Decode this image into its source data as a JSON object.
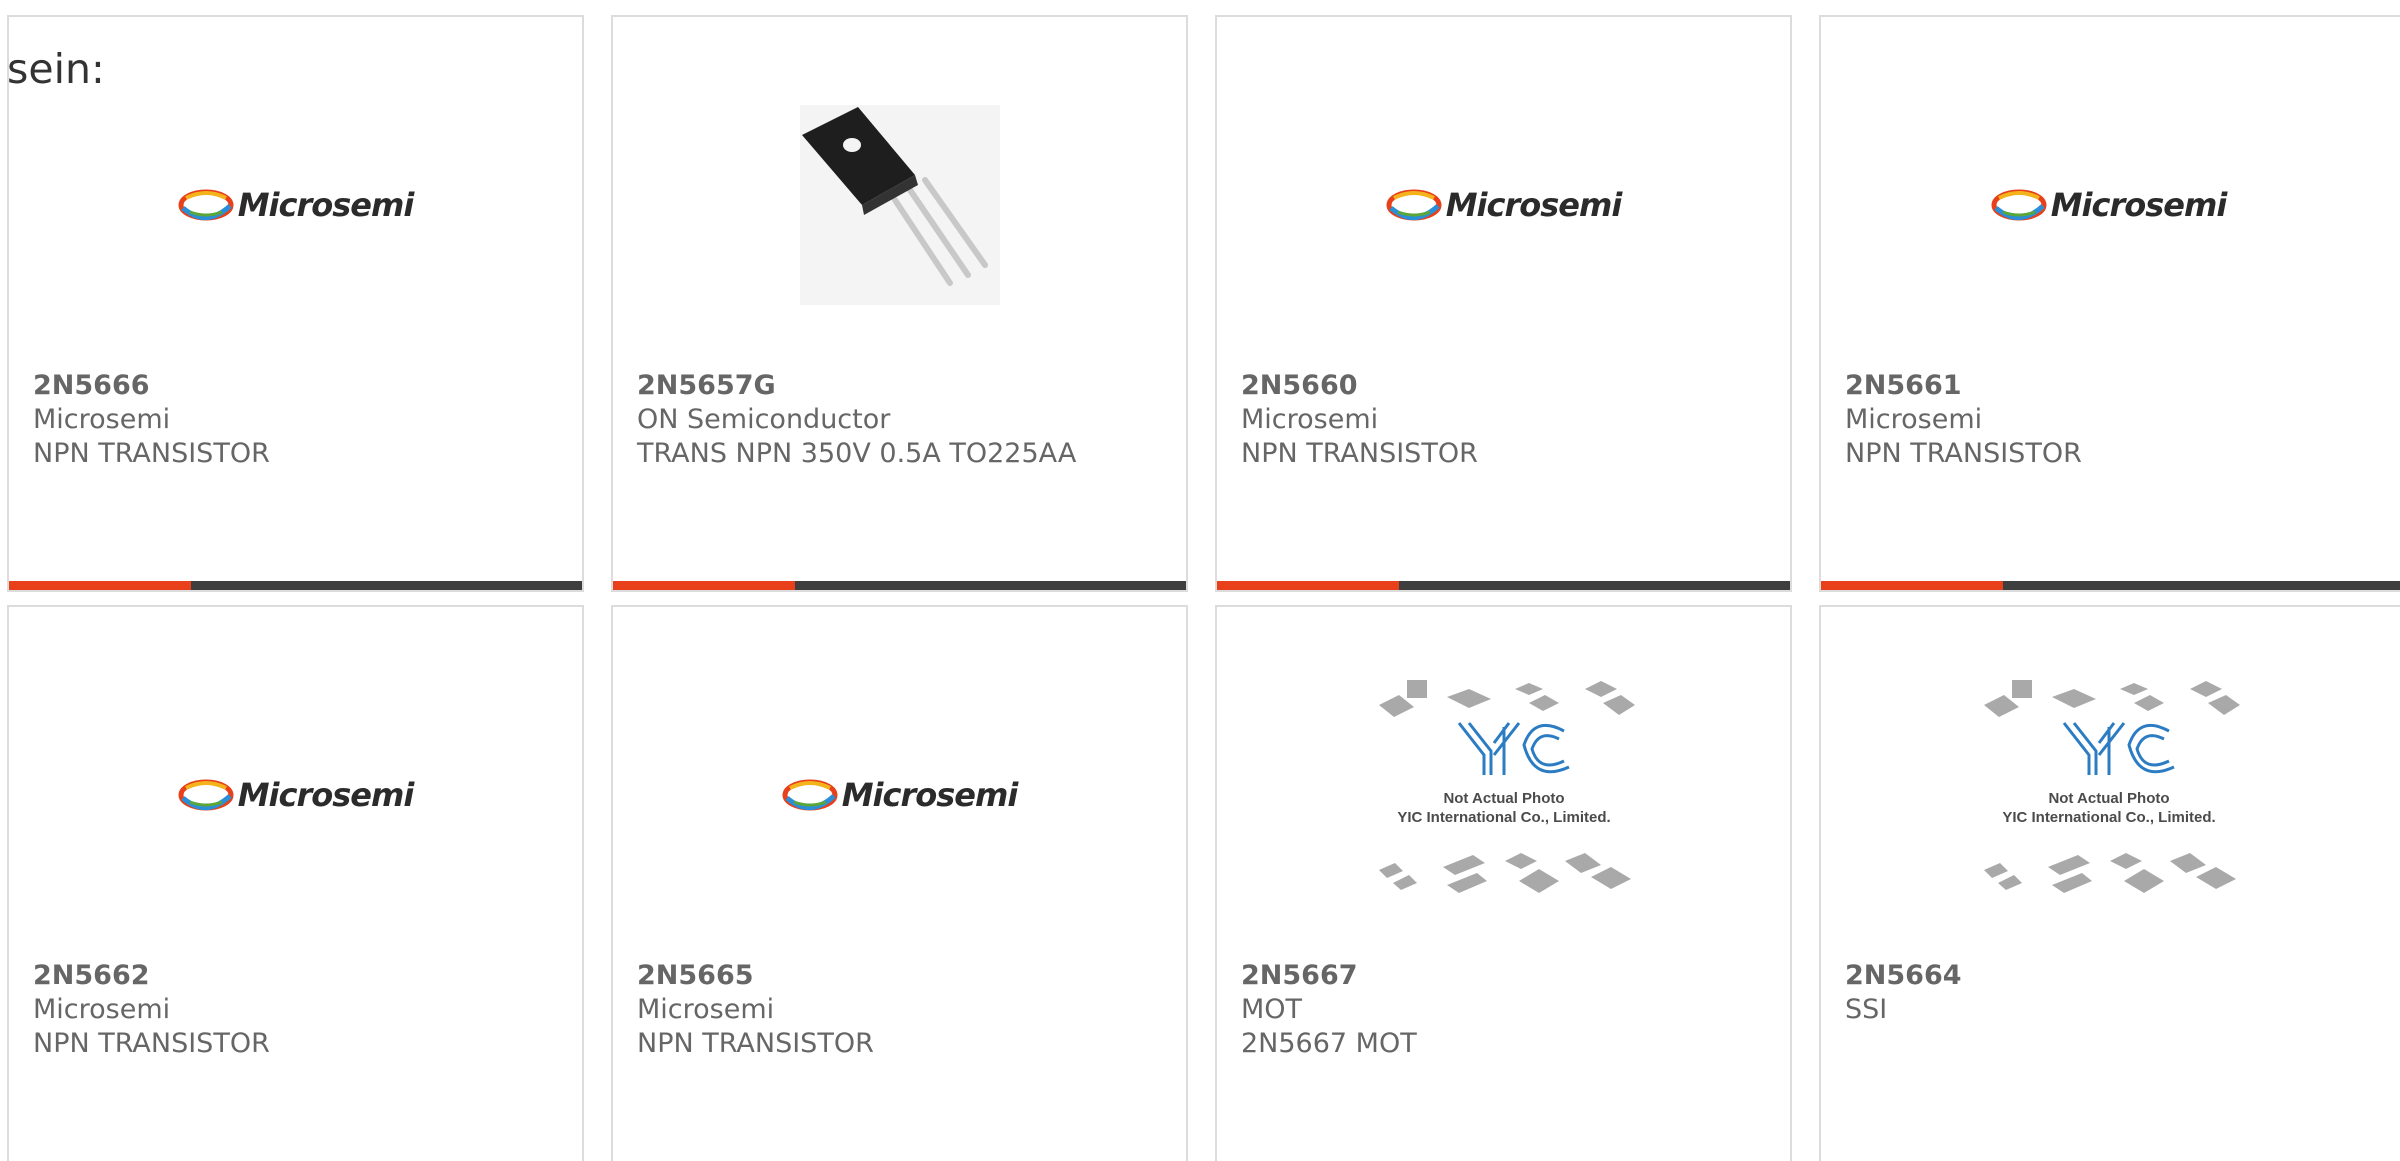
{
  "intro_text": "sein:",
  "brand_colors": {
    "accent_bar": "#e8401a",
    "dark_bar": "#3e3e3e",
    "text": "#666666"
  },
  "logos": {
    "microsemi": "Microsemi",
    "yic_line1": "Not Actual Photo",
    "yic_line2": "YIC International Co., Limited."
  },
  "cards": [
    {
      "part": "2N5666",
      "manufacturer": "Microsemi",
      "description": "NPN TRANSISTOR",
      "image": "microsemi-logo"
    },
    {
      "part": "2N5657G",
      "manufacturer": "ON Semiconductor",
      "description": "TRANS NPN 350V 0.5A TO225AA",
      "image": "transistor-photo"
    },
    {
      "part": "2N5660",
      "manufacturer": "Microsemi",
      "description": "NPN TRANSISTOR",
      "image": "microsemi-logo"
    },
    {
      "part": "2N5661",
      "manufacturer": "Microsemi",
      "description": "NPN TRANSISTOR",
      "image": "microsemi-logo"
    },
    {
      "part": "2N5662",
      "manufacturer": "Microsemi",
      "description": "NPN TRANSISTOR",
      "image": "microsemi-logo"
    },
    {
      "part": "2N5665",
      "manufacturer": "Microsemi",
      "description": "NPN TRANSISTOR",
      "image": "microsemi-logo"
    },
    {
      "part": "2N5667",
      "manufacturer": "MOT",
      "description": "2N5667 MOT",
      "image": "yic-placeholder"
    },
    {
      "part": "2N5664",
      "manufacturer": "SSI",
      "description": "",
      "image": "yic-placeholder"
    }
  ]
}
